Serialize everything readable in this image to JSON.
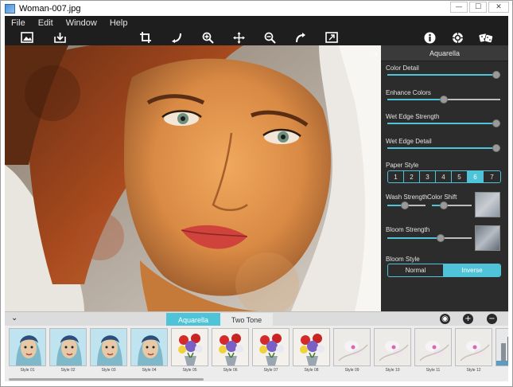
{
  "window": {
    "title": "Woman-007.jpg",
    "controls": {
      "minimize": "—",
      "maximize": "☐",
      "close": "✕"
    }
  },
  "menu": {
    "items": [
      "File",
      "Edit",
      "Window",
      "Help"
    ]
  },
  "toolbar": {
    "icons": [
      "open-image-icon",
      "save-icon",
      "crop-icon",
      "rotate-left-icon",
      "zoom-in-icon",
      "move-icon",
      "zoom-out-icon",
      "redo-icon",
      "fit-screen-icon",
      "info-icon",
      "settings-icon",
      "random-dice-icon"
    ]
  },
  "panel": {
    "title": "Aquarella",
    "color_detail": {
      "label": "Color Detail",
      "value": 1.0
    },
    "enhance_colors": {
      "label": "Enhance Colors",
      "value": 0.5
    },
    "wet_edge_strength": {
      "label": "Wet Edge Strength",
      "value": 1.0
    },
    "wet_edge_detail": {
      "label": "Wet Edge Detail",
      "value": 1.0
    },
    "paper_style": {
      "label": "Paper Style",
      "options": [
        "1",
        "2",
        "3",
        "4",
        "5",
        "6",
        "7"
      ],
      "selected": "6"
    },
    "wash_strength": {
      "label": "Wash Strength",
      "value": 0.45
    },
    "color_shift": {
      "label": "Color Shift",
      "value": 0.25
    },
    "bloom_strength": {
      "label": "Bloom Strength",
      "value": 0.65
    },
    "bloom_style": {
      "label": "Bloom Style",
      "options": [
        "Normal",
        "Inverse"
      ],
      "selected": "Inverse"
    }
  },
  "tabs": {
    "items": [
      "Aquarella",
      "Two Tone"
    ],
    "active": "Aquarella"
  },
  "styles": {
    "items": [
      {
        "label": "Style 01",
        "type": "face"
      },
      {
        "label": "Style 02",
        "type": "face"
      },
      {
        "label": "Style 03",
        "type": "face"
      },
      {
        "label": "Style 04",
        "type": "face"
      },
      {
        "label": "Style 05",
        "type": "flowers"
      },
      {
        "label": "Style 06",
        "type": "flowers"
      },
      {
        "label": "Style 07",
        "type": "flowers"
      },
      {
        "label": "Style 08",
        "type": "flowers"
      },
      {
        "label": "Style 09",
        "type": "orchid"
      },
      {
        "label": "Style 10",
        "type": "orchid"
      },
      {
        "label": "Style 11",
        "type": "orchid"
      },
      {
        "label": "Style 12",
        "type": "orchid"
      },
      {
        "label": "",
        "type": "city"
      }
    ]
  },
  "colors": {
    "accent": "#4fc3d8",
    "panel_bg": "#2c2c2c",
    "toolbar_bg": "#1e1e1e"
  }
}
